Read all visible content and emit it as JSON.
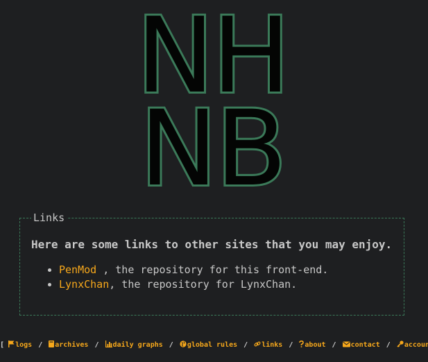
{
  "logo": {
    "line1": "NH",
    "line2": "NB"
  },
  "links_panel": {
    "legend": "Links",
    "intro": "Here are some links to other sites that you may enjoy.",
    "items": [
      {
        "link_text": "PenMod",
        "description": " , the repository for this front-end."
      },
      {
        "link_text": "LynxChan",
        "description": ", the repository for LynxChan."
      }
    ]
  },
  "footer": {
    "open_bracket": "[",
    "close_bracket": "]",
    "separator": "/",
    "links": [
      {
        "label": "logs",
        "icon": "flag-icon"
      },
      {
        "label": "archives",
        "icon": "book-icon"
      },
      {
        "label": "daily graphs",
        "icon": "chart-icon"
      },
      {
        "label": "global rules",
        "icon": "globe-icon"
      },
      {
        "label": "links",
        "icon": "link-icon"
      },
      {
        "label": "about",
        "icon": "question-icon"
      },
      {
        "label": "contact",
        "icon": "envelope-icon"
      },
      {
        "label": "account",
        "icon": "key-icon"
      }
    ]
  },
  "colors": {
    "background": "#1e1f21",
    "accent_green": "#3b7a59",
    "link_orange": "#f7a81b",
    "text": "#c8c8c8"
  }
}
